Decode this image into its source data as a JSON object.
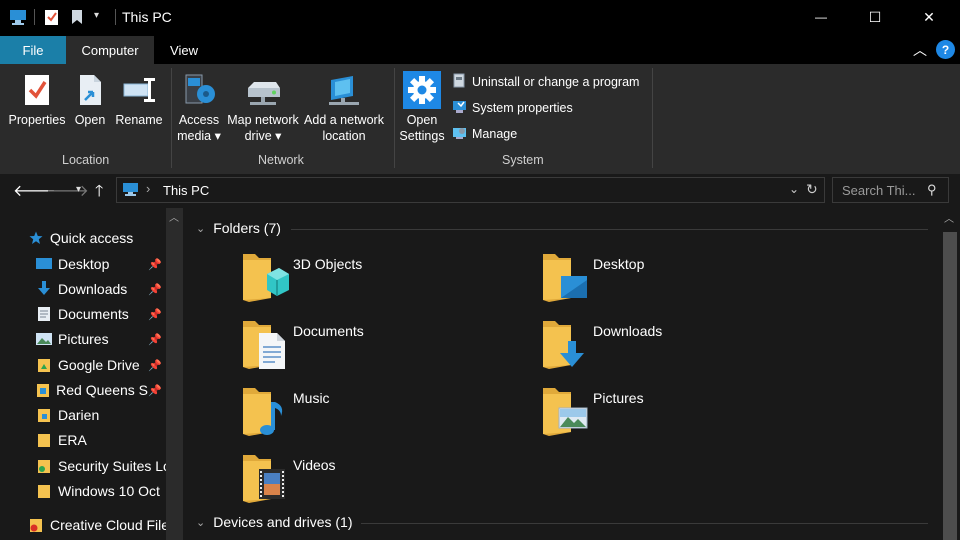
{
  "window": {
    "title": "This PC",
    "minimize_glyph": "—",
    "maximize_glyph": "☐",
    "close_glyph": "✕"
  },
  "tabs": [
    {
      "label": "File"
    },
    {
      "label": "Computer"
    },
    {
      "label": "View"
    }
  ],
  "ribbon": {
    "location": {
      "group": "Location",
      "buttons": [
        {
          "label": "Properties",
          "icon": "properties-icon"
        },
        {
          "label": "Open",
          "icon": "open-icon"
        },
        {
          "label": "Rename",
          "icon": "rename-icon"
        }
      ]
    },
    "network": {
      "group": "Network",
      "access_media": [
        "Access",
        "media ▾"
      ],
      "map_network_drive": [
        "Map network",
        "drive ▾"
      ],
      "add_network_location": [
        "Add a network",
        "location"
      ]
    },
    "system": {
      "group": "System",
      "open_settings": [
        "Open",
        "Settings"
      ],
      "items": [
        {
          "label": "Uninstall or change a program",
          "icon": "uninstall-icon"
        },
        {
          "label": "System properties",
          "icon": "system-properties-icon"
        },
        {
          "label": "Manage",
          "icon": "manage-icon"
        }
      ]
    }
  },
  "address": {
    "path": "This PC",
    "search_placeholder": "Search Thi..."
  },
  "nav": {
    "quick_access": "Quick access",
    "items": [
      {
        "label": "Desktop",
        "pinned": true
      },
      {
        "label": "Downloads",
        "pinned": true
      },
      {
        "label": "Documents",
        "pinned": true
      },
      {
        "label": "Pictures",
        "pinned": true
      },
      {
        "label": "Google Drive",
        "pinned": true
      },
      {
        "label": "Red Queens S",
        "pinned": true
      },
      {
        "label": "Darien",
        "pinned": false
      },
      {
        "label": "ERA",
        "pinned": false
      },
      {
        "label": "Security Suites Lo",
        "pinned": false
      },
      {
        "label": "Windows 10 Oct",
        "pinned": false
      }
    ],
    "creative_cloud": "Creative Cloud Files"
  },
  "content": {
    "folders_header": "Folders (7)",
    "folders": [
      {
        "name": "3D Objects",
        "overlay": "3d-cube"
      },
      {
        "name": "Desktop",
        "overlay": "desktop"
      },
      {
        "name": "Documents",
        "overlay": "document"
      },
      {
        "name": "Downloads",
        "overlay": "download-arrow"
      },
      {
        "name": "Music",
        "overlay": "music-note"
      },
      {
        "name": "Pictures",
        "overlay": "picture"
      },
      {
        "name": "Videos",
        "overlay": "film"
      }
    ],
    "devices_header": "Devices and drives (1)"
  },
  "colors": {
    "accent": "#1b7fa8",
    "folder": "#f4c24f",
    "background": "#191919",
    "ribbon": "#2b2b2b"
  }
}
